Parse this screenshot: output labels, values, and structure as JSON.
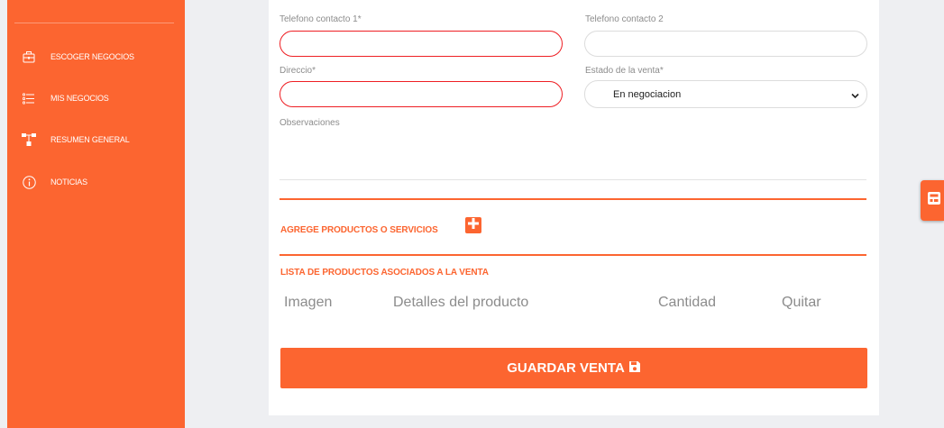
{
  "sidebar": {
    "items": [
      {
        "label": "ESCOGER NEGOCIOS",
        "icon": "briefcase-icon"
      },
      {
        "label": "MIS NEGOCIOS",
        "icon": "list-icon"
      },
      {
        "label": "RESUMEN GENERAL",
        "icon": "sitemap-icon"
      },
      {
        "label": "NOTICIAS",
        "icon": "info-icon"
      }
    ]
  },
  "form": {
    "telefono1_label": "Telefono contacto 1*",
    "telefono1_value": "",
    "telefono2_label": "Telefono contacto 2",
    "telefono2_value": "",
    "direccion_label": "Direccio*",
    "direccion_value": "",
    "estado_label": "Estado de la venta*",
    "estado_value": "En negociacion",
    "observaciones_label": "Observaciones",
    "observaciones_value": ""
  },
  "products": {
    "add_title": "AGREGE PRODUCTOS O SERVICIOS",
    "list_title": "LISTA DE PRODUCTOS ASOCIADOS A LA VENTA",
    "columns": [
      "Imagen",
      "Detalles del producto",
      "Cantidad",
      "Quitar"
    ]
  },
  "actions": {
    "save_label": "GUARDAR VENTA"
  },
  "colors": {
    "accent": "#fc6530",
    "required_border": "#ee1f24"
  }
}
